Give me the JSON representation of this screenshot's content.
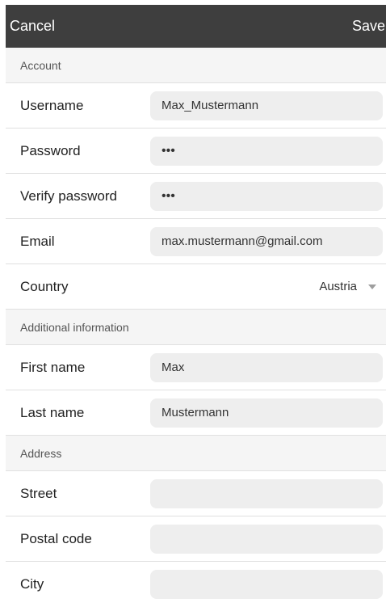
{
  "header": {
    "cancel_label": "Cancel",
    "save_label": "Save"
  },
  "sections": {
    "account": "Account",
    "additional": "Additional information",
    "address": "Address"
  },
  "fields": {
    "username": {
      "label": "Username",
      "value": "Max_Mustermann"
    },
    "password": {
      "label": "Password",
      "value": "•••"
    },
    "verify_password": {
      "label": "Verify password",
      "value": "•••"
    },
    "email": {
      "label": "Email",
      "value": "max.mustermann@gmail.com"
    },
    "country": {
      "label": "Country",
      "value": "Austria",
      "icon": "chevron-down-icon"
    },
    "first_name": {
      "label": "First name",
      "value": "Max"
    },
    "last_name": {
      "label": "Last name",
      "value": "Mustermann"
    },
    "street": {
      "label": "Street",
      "value": ""
    },
    "postal_code": {
      "label": "Postal code",
      "value": ""
    },
    "city": {
      "label": "City",
      "value": ""
    }
  }
}
